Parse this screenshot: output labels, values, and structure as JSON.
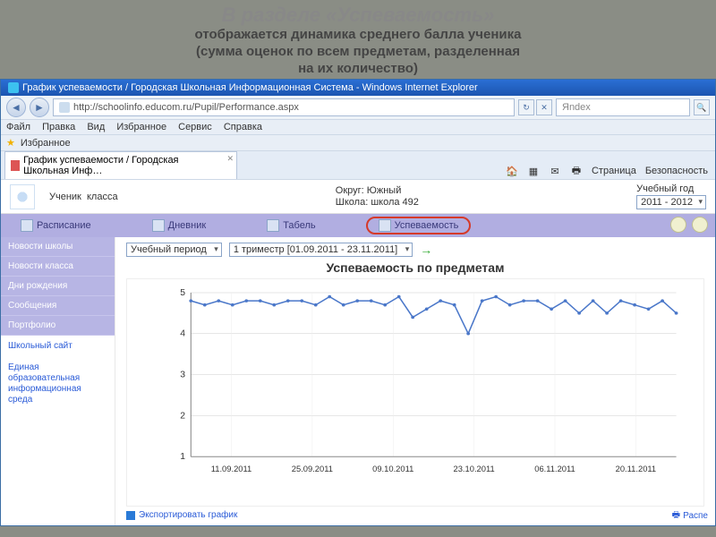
{
  "slide": {
    "title": "В разделе «Успеваемость»",
    "subtitle1": "отображается динамика среднего балла ученика",
    "subtitle2": "(сумма оценок по всем предметам, разделенная",
    "subtitle3": "на их количество)"
  },
  "window": {
    "title": "График успеваемости / Городская Школьная Информационная Система - Windows Internet Explorer"
  },
  "addressbar": {
    "url": "http://schoolinfo.educom.ru/Pupil/Performance.aspx",
    "search_placeholder": "Яndex"
  },
  "menus": {
    "file": "Файл",
    "edit": "Правка",
    "view": "Вид",
    "fav": "Избранное",
    "tools": "Сервис",
    "help": "Справка"
  },
  "favbar": {
    "favorites": "Избранное",
    "tab_label": "График успеваемости / Городская Школьная Инф…"
  },
  "toolbar": {
    "home": "",
    "page": "Страница",
    "safety": "Безопасность"
  },
  "header": {
    "student_label": "Ученик",
    "class_label": "класса",
    "okrug_label": "Округ:",
    "okrug_value": "Южный",
    "school_label": "Школа:",
    "school_value": "школа 492",
    "year_label": "Учебный год",
    "year_value": "2011 - 2012"
  },
  "nav": {
    "schedule": "Расписание",
    "diary": "Дневник",
    "report": "Табель",
    "performance": "Успеваемость"
  },
  "sidebar": {
    "items": [
      "Новости школы",
      "Новости класса",
      "Дни рождения",
      "Сообщения",
      "Портфолио"
    ],
    "links": [
      "Школьный сайт",
      "Единая образовательная информационная среда"
    ]
  },
  "filters": {
    "period_label": "Учебный период",
    "period_value": "1 триместр [01.09.2011 - 23.11.2011]"
  },
  "chart": {
    "title": "Успеваемость по предметам",
    "export": "Экспортировать график",
    "print": "Распе"
  },
  "chart_data": {
    "type": "line",
    "title": "Успеваемость по предметам",
    "xlabel": "",
    "ylabel": "",
    "ylim": [
      1,
      5
    ],
    "x_ticks": [
      "11.09.2011",
      "25.09.2011",
      "09.10.2011",
      "23.10.2011",
      "06.11.2011",
      "20.11.2011"
    ],
    "x": [
      0,
      1,
      2,
      3,
      4,
      5,
      6,
      7,
      8,
      9,
      10,
      11,
      12,
      13,
      14,
      15,
      16,
      17,
      18,
      19,
      20,
      21,
      22,
      23,
      24,
      25,
      26,
      27,
      28,
      29,
      30,
      31,
      32,
      33,
      34,
      35
    ],
    "values": [
      4.8,
      4.7,
      4.8,
      4.7,
      4.8,
      4.8,
      4.7,
      4.8,
      4.8,
      4.7,
      4.9,
      4.7,
      4.8,
      4.8,
      4.7,
      4.9,
      4.4,
      4.6,
      4.8,
      4.7,
      4.0,
      4.8,
      4.9,
      4.7,
      4.8,
      4.8,
      4.6,
      4.8,
      4.5,
      4.8,
      4.5,
      4.8,
      4.7,
      4.6,
      4.8,
      4.5
    ]
  }
}
